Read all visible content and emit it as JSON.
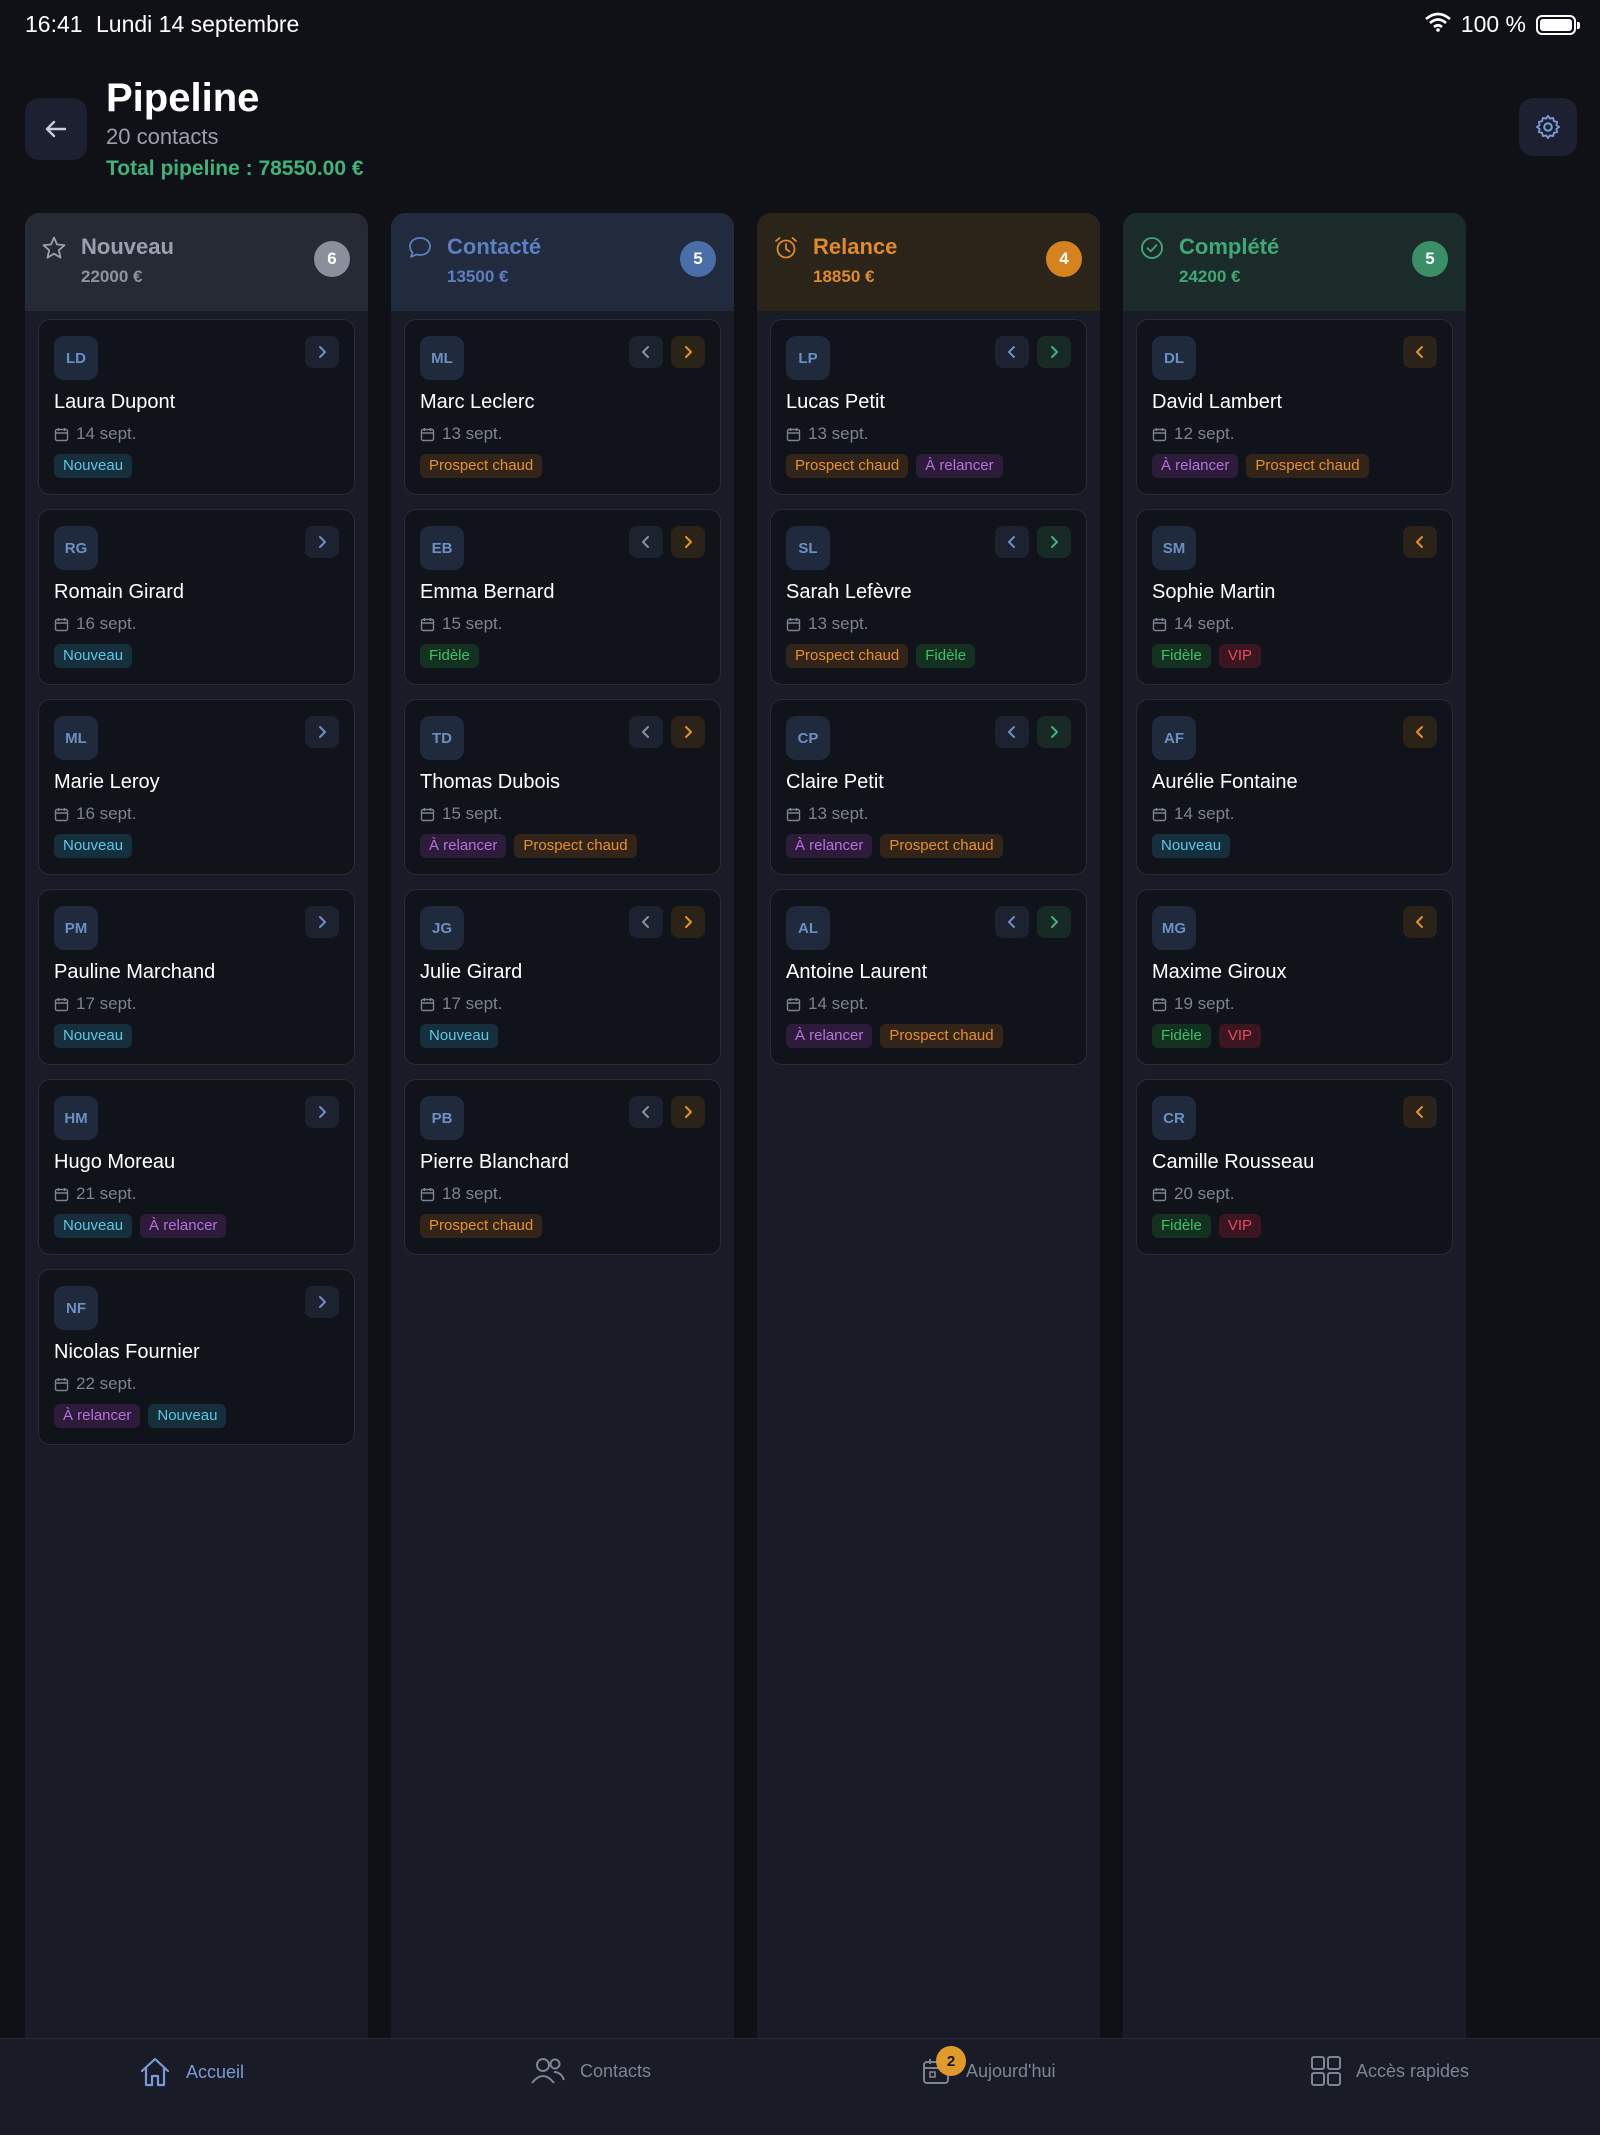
{
  "status": {
    "time": "16:41",
    "date": "Lundi 14 septembre",
    "battery": "100 %"
  },
  "header": {
    "title": "Pipeline",
    "subtitle": "20 contacts",
    "total": "Total pipeline : 78550.00 €"
  },
  "colors": {
    "nouveau": "#9aa0ae",
    "contacte": "#5b7fc0",
    "relance": "#e08a2a",
    "complete": "#3fa877"
  },
  "columns": [
    {
      "title": "Nouveau",
      "amount": "22000 €",
      "count": "6",
      "icon": "star-icon",
      "cards": [
        {
          "initials": "LD",
          "name": "Laura Dupont",
          "date": "14 sept.",
          "tags": [
            {
              "label": "Nouveau",
              "kind": "nouveau"
            }
          ],
          "nav": [
            "next"
          ]
        },
        {
          "initials": "RG",
          "name": "Romain Girard",
          "date": "16 sept.",
          "tags": [
            {
              "label": "Nouveau",
              "kind": "nouveau"
            }
          ],
          "nav": [
            "next"
          ]
        },
        {
          "initials": "ML",
          "name": "Marie Leroy",
          "date": "16 sept.",
          "tags": [
            {
              "label": "Nouveau",
              "kind": "nouveau"
            }
          ],
          "nav": [
            "next"
          ]
        },
        {
          "initials": "PM",
          "name": "Pauline Marchand",
          "date": "17 sept.",
          "tags": [
            {
              "label": "Nouveau",
              "kind": "nouveau"
            }
          ],
          "nav": [
            "next"
          ]
        },
        {
          "initials": "HM",
          "name": "Hugo Moreau",
          "date": "21 sept.",
          "tags": [
            {
              "label": "Nouveau",
              "kind": "nouveau"
            },
            {
              "label": "À relancer",
              "kind": "relancer"
            }
          ],
          "nav": [
            "next"
          ]
        },
        {
          "initials": "NF",
          "name": "Nicolas Fournier",
          "date": "22 sept.",
          "tags": [
            {
              "label": "À relancer",
              "kind": "relancer"
            },
            {
              "label": "Nouveau",
              "kind": "nouveau"
            }
          ],
          "nav": [
            "next"
          ]
        }
      ]
    },
    {
      "title": "Contacté",
      "amount": "13500 €",
      "count": "5",
      "icon": "chat-bubble-icon",
      "cards": [
        {
          "initials": "ML",
          "name": "Marc Leclerc",
          "date": "13 sept.",
          "tags": [
            {
              "label": "Prospect chaud",
              "kind": "prospect"
            }
          ],
          "nav": [
            "prev",
            "next"
          ]
        },
        {
          "initials": "EB",
          "name": "Emma Bernard",
          "date": "15 sept.",
          "tags": [
            {
              "label": "Fidèle",
              "kind": "fidele"
            }
          ],
          "nav": [
            "prev",
            "next"
          ]
        },
        {
          "initials": "TD",
          "name": "Thomas Dubois",
          "date": "15 sept.",
          "tags": [
            {
              "label": "À relancer",
              "kind": "relancer"
            },
            {
              "label": "Prospect chaud",
              "kind": "prospect"
            }
          ],
          "nav": [
            "prev",
            "next"
          ]
        },
        {
          "initials": "JG",
          "name": "Julie Girard",
          "date": "17 sept.",
          "tags": [
            {
              "label": "Nouveau",
              "kind": "nouveau"
            }
          ],
          "nav": [
            "prev",
            "next"
          ]
        },
        {
          "initials": "PB",
          "name": "Pierre Blanchard",
          "date": "18 sept.",
          "tags": [
            {
              "label": "Prospect chaud",
              "kind": "prospect"
            }
          ],
          "nav": [
            "prev",
            "next"
          ]
        }
      ]
    },
    {
      "title": "Relance",
      "amount": "18850 €",
      "count": "4",
      "icon": "alarm-clock-icon",
      "cards": [
        {
          "initials": "LP",
          "name": "Lucas Petit",
          "date": "13 sept.",
          "tags": [
            {
              "label": "Prospect chaud",
              "kind": "prospect"
            },
            {
              "label": "À relancer",
              "kind": "relancer"
            }
          ],
          "nav": [
            "prev",
            "next"
          ]
        },
        {
          "initials": "SL",
          "name": "Sarah Lefèvre",
          "date": "13 sept.",
          "tags": [
            {
              "label": "Prospect chaud",
              "kind": "prospect"
            },
            {
              "label": "Fidèle",
              "kind": "fidele"
            }
          ],
          "nav": [
            "prev",
            "next"
          ]
        },
        {
          "initials": "CP",
          "name": "Claire Petit",
          "date": "13 sept.",
          "tags": [
            {
              "label": "À relancer",
              "kind": "relancer"
            },
            {
              "label": "Prospect chaud",
              "kind": "prospect"
            }
          ],
          "nav": [
            "prev",
            "next"
          ]
        },
        {
          "initials": "AL",
          "name": "Antoine Laurent",
          "date": "14 sept.",
          "tags": [
            {
              "label": "À relancer",
              "kind": "relancer"
            },
            {
              "label": "Prospect chaud",
              "kind": "prospect"
            }
          ],
          "nav": [
            "prev",
            "next"
          ]
        }
      ]
    },
    {
      "title": "Complété",
      "amount": "24200 €",
      "count": "5",
      "icon": "check-circle-icon",
      "cards": [
        {
          "initials": "DL",
          "name": "David Lambert",
          "date": "12 sept.",
          "tags": [
            {
              "label": "À relancer",
              "kind": "relancer"
            },
            {
              "label": "Prospect chaud",
              "kind": "prospect"
            }
          ],
          "nav": [
            "prev"
          ]
        },
        {
          "initials": "SM",
          "name": "Sophie Martin",
          "date": "14 sept.",
          "tags": [
            {
              "label": "Fidèle",
              "kind": "fidele"
            },
            {
              "label": "VIP",
              "kind": "vip"
            }
          ],
          "nav": [
            "prev"
          ]
        },
        {
          "initials": "AF",
          "name": "Aurélie Fontaine",
          "date": "14 sept.",
          "tags": [
            {
              "label": "Nouveau",
              "kind": "nouveau"
            }
          ],
          "nav": [
            "prev"
          ]
        },
        {
          "initials": "MG",
          "name": "Maxime Giroux",
          "date": "19 sept.",
          "tags": [
            {
              "label": "Fidèle",
              "kind": "fidele"
            },
            {
              "label": "VIP",
              "kind": "vip"
            }
          ],
          "nav": [
            "prev"
          ]
        },
        {
          "initials": "CR",
          "name": "Camille Rousseau",
          "date": "20 sept.",
          "tags": [
            {
              "label": "Fidèle",
              "kind": "fidele"
            },
            {
              "label": "VIP",
              "kind": "vip"
            }
          ],
          "nav": [
            "prev"
          ]
        }
      ]
    }
  ],
  "tabs": [
    {
      "label": "Accueil",
      "icon": "home-icon",
      "active": true
    },
    {
      "label": "Contacts",
      "icon": "users-icon",
      "active": false
    },
    {
      "label": "Aujourd'hui",
      "icon": "calendar-icon",
      "active": false,
      "badge": "2"
    },
    {
      "label": "Accès rapides",
      "icon": "grid-icon",
      "active": false
    }
  ]
}
